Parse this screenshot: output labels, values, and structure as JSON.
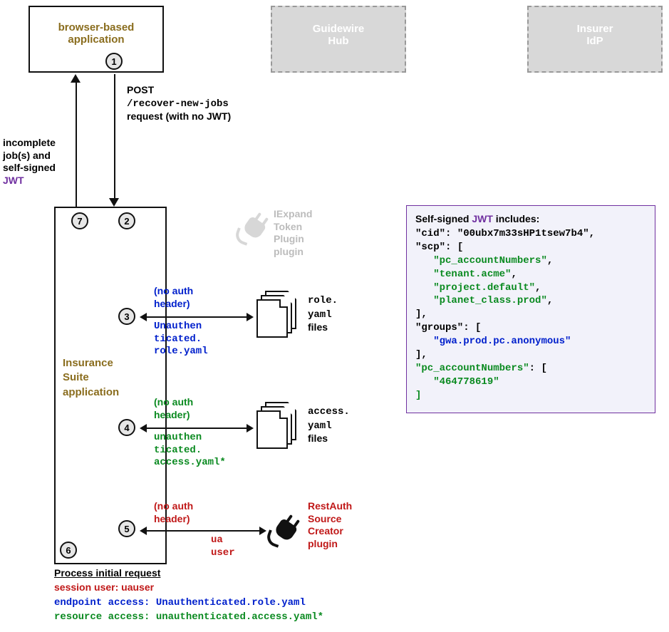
{
  "boxes": {
    "browser": "browser-based application",
    "hub_l1": "Guidewire",
    "hub_l2": "Hub",
    "idp_l1": "Insurer",
    "idp_l2": "IdP",
    "app_l1": "Insurance",
    "app_l2": "Suite",
    "app_l3": "application"
  },
  "steps": {
    "s1": "1",
    "s2": "2",
    "s3": "3",
    "s4": "4",
    "s5": "5",
    "s6": "6",
    "s7": "7"
  },
  "arrow_down": {
    "l1": "POST",
    "l2": "/recover-new-jobs",
    "l3": "request (with no JWT)"
  },
  "arrow_up": {
    "l1": "incomplete",
    "l2": "job(s) and",
    "l3": "self-signed",
    "jwt": "JWT"
  },
  "iexpand": {
    "l1": "IExpand",
    "l2": "Token",
    "l3": "Plugin",
    "l4": "plugin"
  },
  "row3": {
    "noauth1": "(no auth",
    "noauth2": "header)",
    "ret1": "Unauthen",
    "ret2": "ticated.",
    "ret3": "role.yaml",
    "side1": "role.",
    "side2": "yaml",
    "side3": "files"
  },
  "row4": {
    "noauth1": "(no auth",
    "noauth2": "header)",
    "ret1": "unauthen",
    "ret2": "ticated.",
    "ret3": "access.yaml*",
    "side1": "access.",
    "side2": "yaml",
    "side3": "files"
  },
  "row5": {
    "noauth1": "(no auth",
    "noauth2": "header)",
    "ret1": "ua",
    "ret2": "user",
    "side1": "RestAuth",
    "side2": "Source",
    "side3": "Creator",
    "side4": "plugin"
  },
  "process": {
    "title": "Process initial request",
    "session": "session user: uauser",
    "endpoint": "endpoint access: Unauthenticated.role.yaml",
    "resource": "resource access: unauthenticated.access.yaml*"
  },
  "jwt_title_pre": "Self-signed ",
  "jwt_title_jwt": "JWT",
  "jwt_title_post": " includes:",
  "jwt": {
    "cid_k": "\"cid\"",
    "cid_v": "\"00ubx7m33sHP1tsew7b4\"",
    "scp_k": "\"scp\"",
    "scp_v1": "\"pc_accountNumbers\"",
    "scp_v2": "\"tenant.acme\"",
    "scp_v3": "\"project.default\"",
    "scp_v4": "\"planet_class.prod\"",
    "groups_k": "\"groups\"",
    "groups_v1": "\"gwa.prod.pc.anonymous\"",
    "acct_k": "\"pc_accountNumbers\"",
    "acct_v1": "\"464778619\""
  }
}
